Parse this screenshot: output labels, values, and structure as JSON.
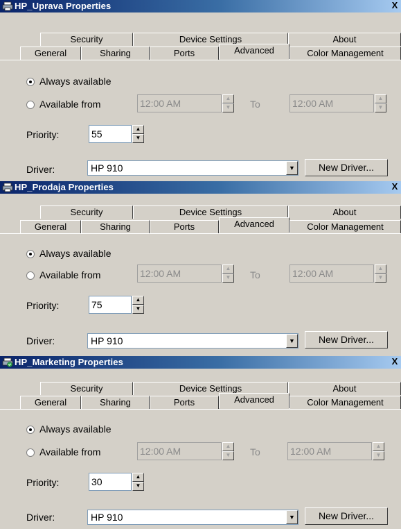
{
  "windows": [
    {
      "title": "HP_Uprava Properties",
      "close": "X",
      "tabs_row1": [
        "Security",
        "Device Settings",
        "About"
      ],
      "tabs_row2": [
        "General",
        "Sharing",
        "Ports",
        "Advanced",
        "Color Management"
      ],
      "active_tab": "Advanced",
      "always_available": "Always available",
      "available_from": "Available from",
      "from_time": "12:00 AM",
      "to_label": "To",
      "to_time": "12:00 AM",
      "priority_label": "Priority:",
      "priority_value": "55",
      "driver_label": "Driver:",
      "driver_value": "HP 910",
      "new_driver": "New Driver..."
    },
    {
      "title": "HP_Prodaja Properties",
      "close": "X",
      "tabs_row1": [
        "Security",
        "Device Settings",
        "About"
      ],
      "tabs_row2": [
        "General",
        "Sharing",
        "Ports",
        "Advanced",
        "Color Management"
      ],
      "active_tab": "Advanced",
      "always_available": "Always available",
      "available_from": "Available from",
      "from_time": "12:00 AM",
      "to_label": "To",
      "to_time": "12:00 AM",
      "priority_label": "Priority:",
      "priority_value": "75",
      "driver_label": "Driver:",
      "driver_value": "HP 910",
      "new_driver": "New Driver..."
    },
    {
      "title": "HP_Marketing Properties",
      "close": "X",
      "tabs_row1": [
        "Security",
        "Device Settings",
        "About"
      ],
      "tabs_row2": [
        "General",
        "Sharing",
        "Ports",
        "Advanced",
        "Color Management"
      ],
      "active_tab": "Advanced",
      "always_available": "Always available",
      "available_from": "Available from",
      "from_time": "12:00 AM",
      "to_label": "To",
      "to_time": "12:00 AM",
      "priority_label": "Priority:",
      "priority_value": "30",
      "driver_label": "Driver:",
      "driver_value": "HP 910",
      "new_driver": "New Driver..."
    }
  ]
}
